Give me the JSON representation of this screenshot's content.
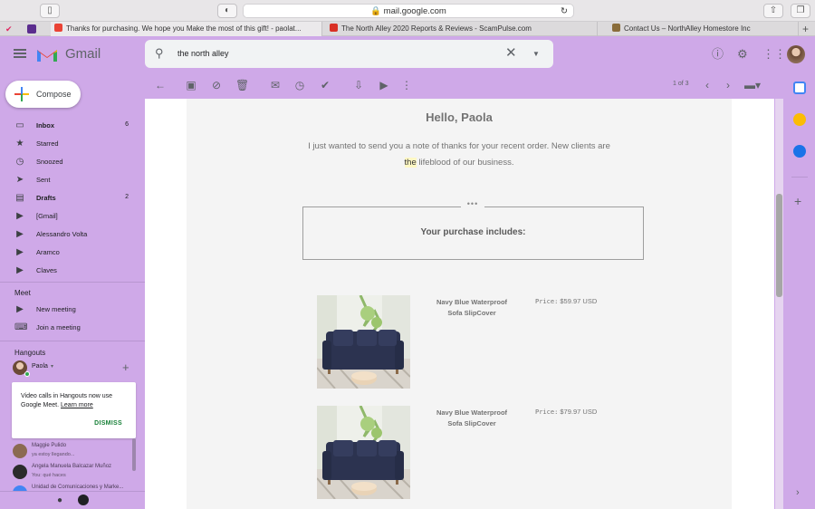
{
  "browser": {
    "url": "mail.google.com",
    "tabs": [
      {
        "title": "Thanks for purchasing. We hope you Make the most of this gift! - paolat...",
        "favicon_color": "#ea4335"
      },
      {
        "title": "The North Alley 2020 Reports & Reviews - ScamPulse.com",
        "favicon_color": "#d93025"
      },
      {
        "title": "Contact Us – NorthAlley Homestore Inc",
        "favicon_color": "#8a6d3b"
      }
    ]
  },
  "gmail": {
    "app_name": "Gmail",
    "search_query": "the north alley",
    "compose_label": "Compose",
    "pager": "1 of 3",
    "nav": [
      {
        "label": "Inbox",
        "count": "6",
        "bold": true,
        "icon": "inbox-icon"
      },
      {
        "label": "Starred",
        "count": "",
        "bold": false,
        "icon": "star-icon"
      },
      {
        "label": "Snoozed",
        "count": "",
        "bold": false,
        "icon": "clock-icon"
      },
      {
        "label": "Sent",
        "count": "",
        "bold": false,
        "icon": "send-icon"
      },
      {
        "label": "Drafts",
        "count": "2",
        "bold": true,
        "icon": "draft-icon"
      },
      {
        "label": "[Gmail]",
        "count": "",
        "bold": false,
        "icon": "label-icon"
      },
      {
        "label": "Alessandro Volta",
        "count": "",
        "bold": false,
        "icon": "label-icon"
      },
      {
        "label": "Aramco",
        "count": "",
        "bold": false,
        "icon": "label-icon"
      },
      {
        "label": "Claves",
        "count": "",
        "bold": false,
        "icon": "label-icon"
      }
    ],
    "meet": {
      "title": "Meet",
      "items": [
        {
          "label": "New meeting",
          "icon": "video-icon"
        },
        {
          "label": "Join a meeting",
          "icon": "keyboard-icon"
        }
      ]
    },
    "hangouts": {
      "title": "Hangouts",
      "user": "Paola",
      "card_text": "Video calls in Hangouts now use Google Meet.",
      "learn_more": "Learn more",
      "dismiss": "DISMISS",
      "contacts": [
        {
          "name": "Maggie Pulido",
          "sub": "ya estoy llegando..."
        },
        {
          "name": "Angela Manuela Balcazar Muñoz",
          "sub": "You: qué haces"
        },
        {
          "name": "Unidad de Comunicaciones y Marke...",
          "sub": ""
        }
      ]
    }
  },
  "email": {
    "greeting": "Hello, Paola",
    "body_part1": "I just wanted to send you a note of thanks for your recent order. New clients are",
    "body_highlight": "the",
    "body_part2": "lifeblood of our business.",
    "dots": "•••",
    "purchase_title": "Your purchase includes:",
    "products": [
      {
        "name": "Navy Blue Waterproof Sofa SlipCover",
        "price_label": "Price:",
        "price": "$59.97 USD"
      },
      {
        "name": "Navy Blue Waterproof Sofa SlipCover",
        "price_label": "Price:",
        "price": "$79.97 USD"
      }
    ]
  }
}
